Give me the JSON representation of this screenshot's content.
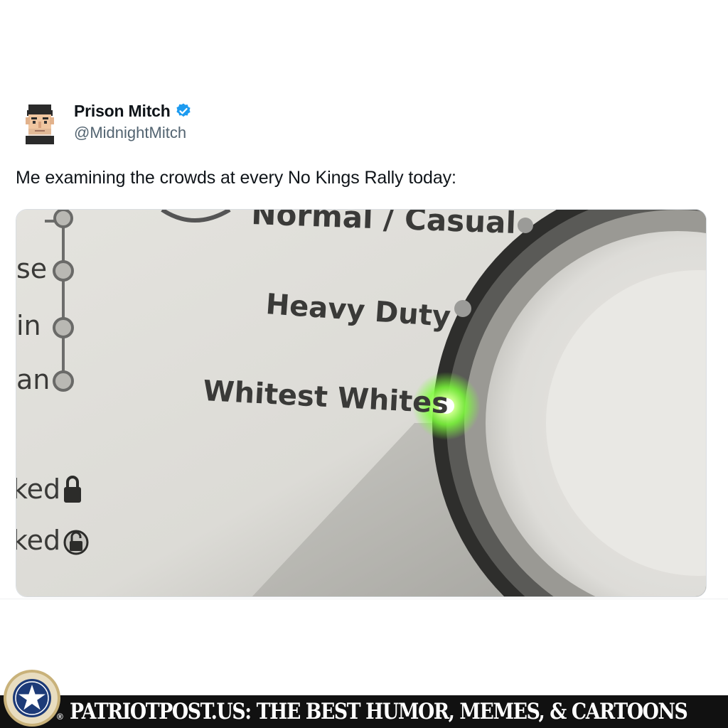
{
  "tweet": {
    "display_name": "Prison Mitch",
    "handle": "@MidnightMitch",
    "text": "Me examining the crowds at every No Kings Rally today:",
    "verified_icon": "verified-badge-icon",
    "colors": {
      "name": "#0f1419",
      "handle": "#536471",
      "verified": "#1d9bf0"
    }
  },
  "photo": {
    "dial_labels": [
      "Normal / Casual",
      "Heavy Duty",
      "Whitest Whites"
    ],
    "left_labels": [
      "se",
      "in",
      "an"
    ],
    "lock_labels": [
      "ked",
      "ked"
    ],
    "selected_setting": "Whitest Whites",
    "indicator_color": "#7dff3a"
  },
  "footer": {
    "text": "PATRIOTPOST.US: THE BEST HUMOR, MEMES, & CARTOONS",
    "registered_mark": "®",
    "logo_icon": "star-seal-icon",
    "background": "#111111"
  }
}
